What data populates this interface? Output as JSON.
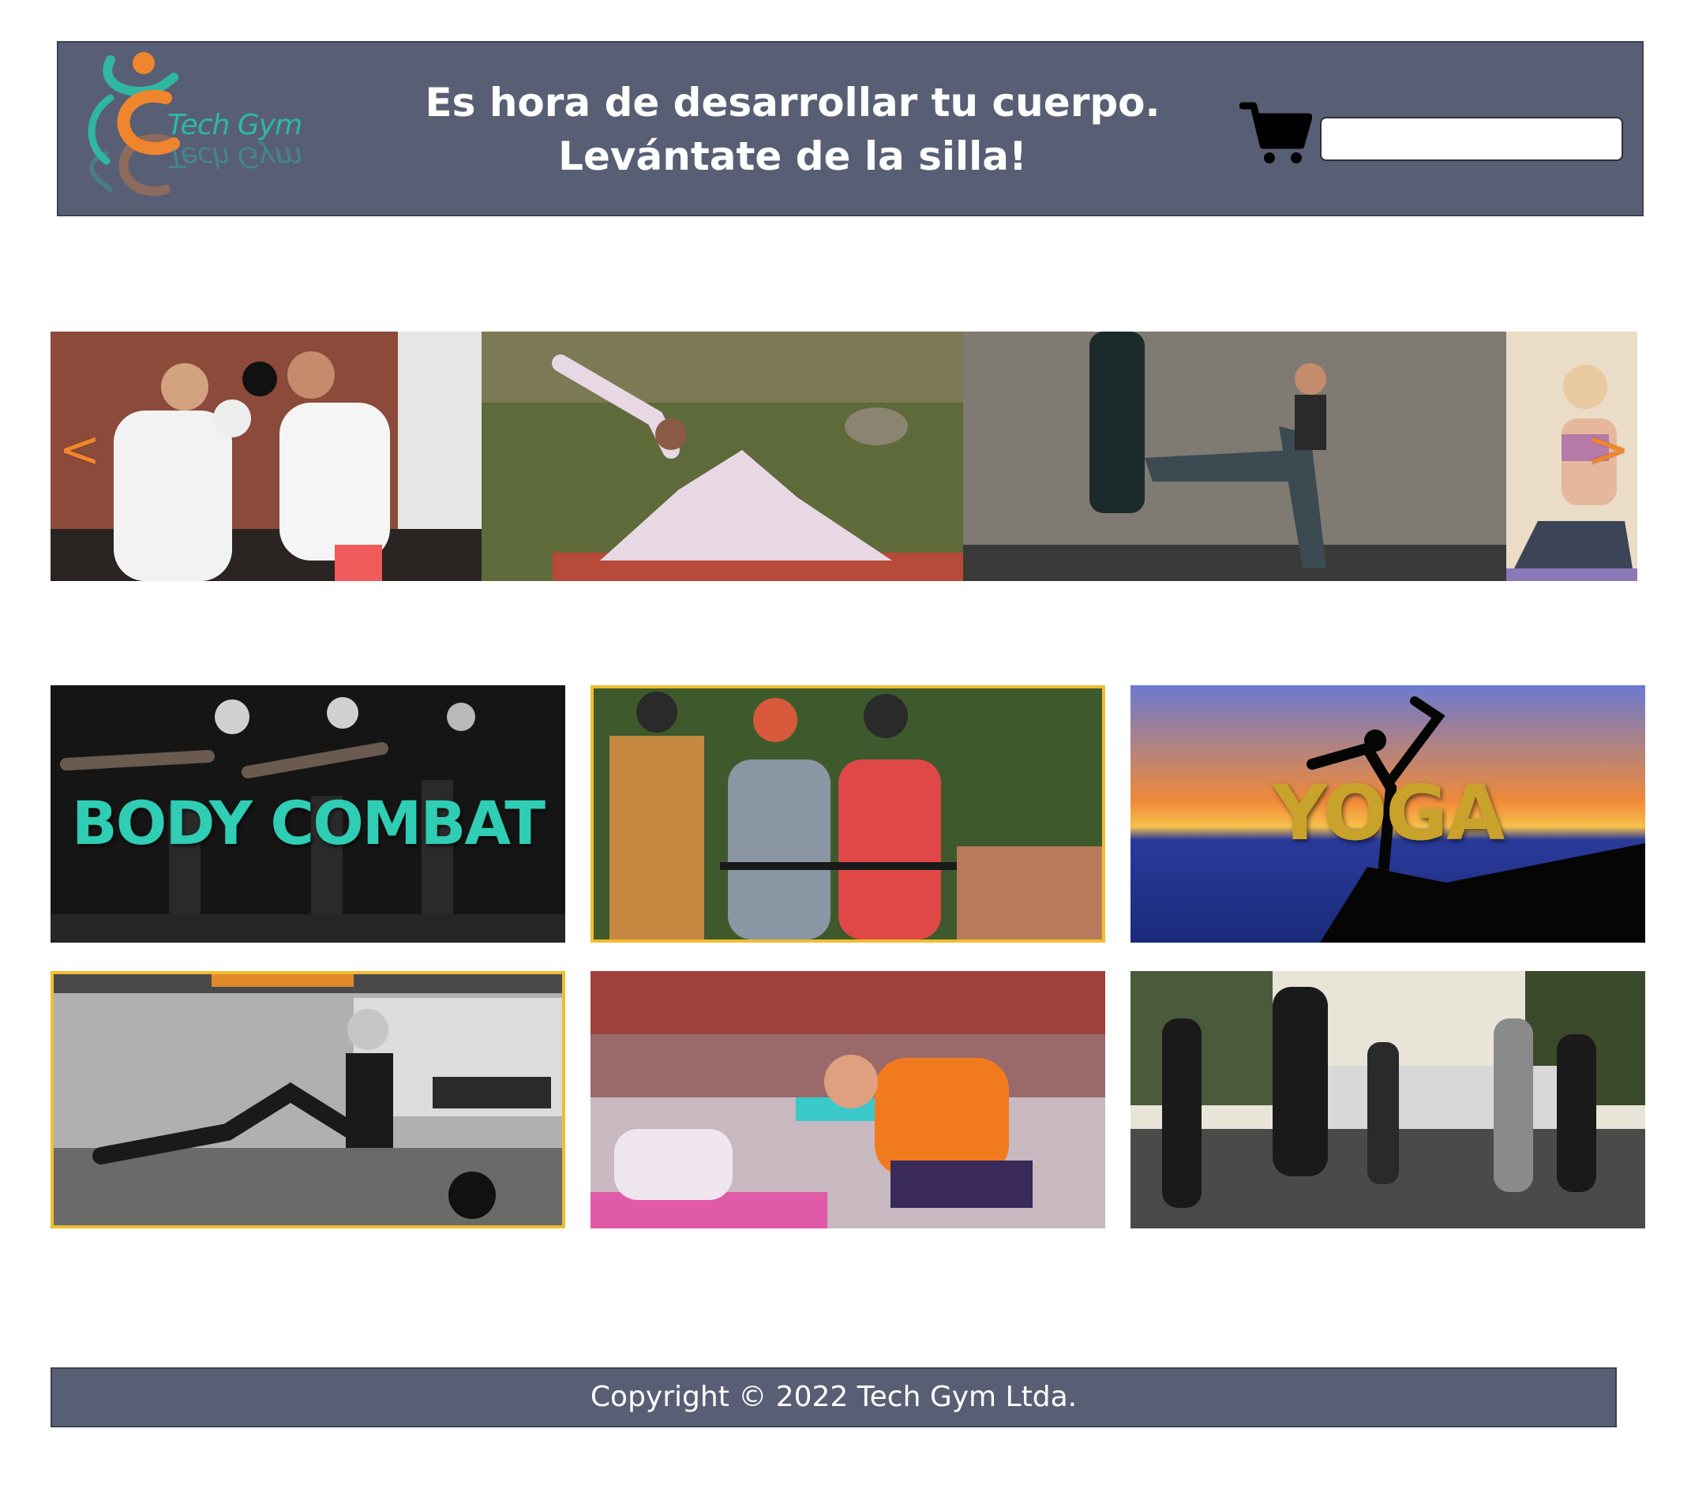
{
  "header": {
    "logo_text": "Tech Gym",
    "headline_line1": "Es hora de desarrollar tu cuerpo.",
    "headline_line2": "Levántate de la silla!",
    "search": {
      "value": "",
      "placeholder": ""
    },
    "cart_icon": "shopping-cart-icon"
  },
  "carousel": {
    "prev_label": "<",
    "next_label": ">",
    "slides": [
      "boxing-mitts-photo",
      "outdoor-yoga-photo",
      "kickboxing-bag-photo",
      "yoga-woman-photo"
    ]
  },
  "cards": [
    {
      "label": "BODY COMBAT",
      "photo": "body-combat-class-photo",
      "selected": false
    },
    {
      "label": "",
      "photo": "cycling-group-photo",
      "selected": true
    },
    {
      "label": "YOGA",
      "photo": "yoga-sunset-photo",
      "selected": false
    },
    {
      "label": "",
      "photo": "functional-training-photo",
      "selected": true
    },
    {
      "label": "",
      "photo": "stretching-class-photo",
      "selected": false
    },
    {
      "label": "",
      "photo": "outdoor-running-group-photo",
      "selected": false
    }
  ],
  "footer": {
    "copyright": "Copyright © 2022 Tech Gym Ltda."
  },
  "colors": {
    "header_bg": "#585f75",
    "accent_orange": "#f0852d",
    "selected_border": "#f2bd30",
    "body_combat_text": "#2fcdb3",
    "yoga_text": "#c9a22b",
    "logo_teal": "#2fb7a2"
  }
}
